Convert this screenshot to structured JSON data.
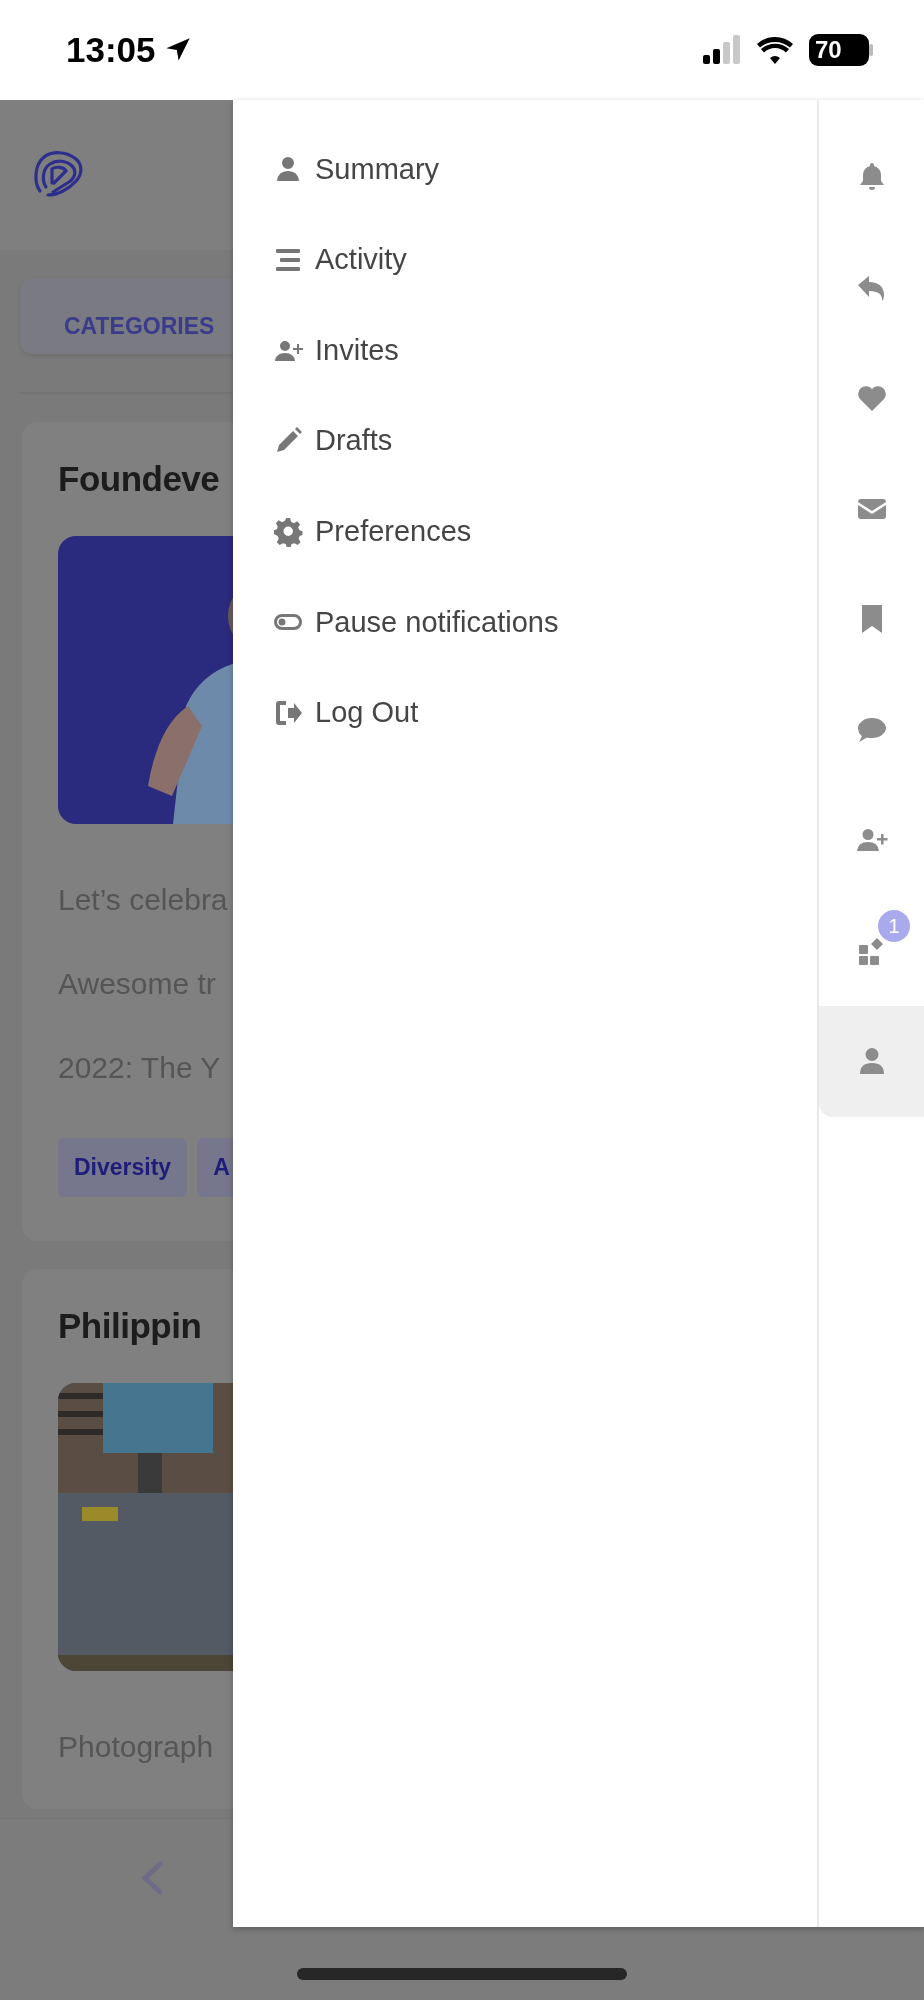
{
  "status_bar": {
    "time": "13:05",
    "battery": "70"
  },
  "page": {
    "categories_button": "CATEGORIES",
    "cards": [
      {
        "title": "Foundeve",
        "picture": {
          "kind": "picture"
        },
        "lines": [
          "Let’s celebra",
          "Awesome tr",
          "2022: The Y"
        ],
        "tags": [
          "Diversity",
          "A"
        ]
      },
      {
        "title": "Philippin",
        "picture": {
          "kind": "picture"
        },
        "lines": [
          "Photograph"
        ]
      }
    ]
  },
  "drawer": {
    "menu": [
      {
        "label": "Summary"
      },
      {
        "label": "Activity"
      },
      {
        "label": "Invites"
      },
      {
        "label": "Drafts"
      },
      {
        "label": "Preferences"
      },
      {
        "label": "Pause notifications"
      },
      {
        "label": "Log Out"
      }
    ],
    "rail": [
      {
        "selected": false
      },
      {
        "selected": false
      },
      {
        "selected": false
      },
      {
        "selected": false
      },
      {
        "selected": false
      },
      {
        "selected": false
      },
      {
        "selected": false
      },
      {
        "selected": false,
        "badge": "1"
      },
      {
        "selected": true
      }
    ]
  }
}
